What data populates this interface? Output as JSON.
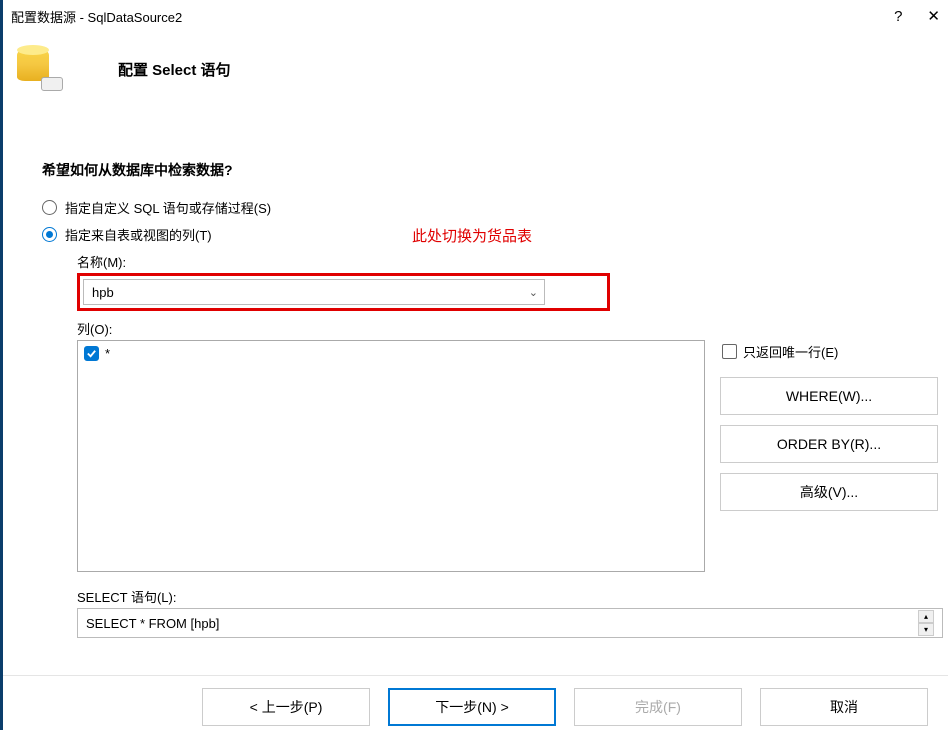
{
  "titlebar": {
    "title": "配置数据源 - SqlDataSource2"
  },
  "header": {
    "title": "配置 Select 语句"
  },
  "question": "希望如何从数据库中检索数据?",
  "radios": {
    "custom_sql": "指定自定义 SQL 语句或存储过程(S)",
    "from_table": "指定来自表或视图的列(T)"
  },
  "annotation": "此处切换为货品表",
  "name_label": "名称(M):",
  "dropdown_value": "hpb",
  "columns_label": "列(O):",
  "column_items": {
    "star": "*"
  },
  "only_one_row": "只返回唯一行(E)",
  "buttons": {
    "where": "WHERE(W)...",
    "orderby": "ORDER BY(R)...",
    "advanced": "高级(V)..."
  },
  "select_label": "SELECT 语句(L):",
  "select_value": "SELECT * FROM [hpb]",
  "footer": {
    "prev": "< 上一步(P)",
    "next": "下一步(N) >",
    "finish": "完成(F)",
    "cancel": "取消"
  }
}
